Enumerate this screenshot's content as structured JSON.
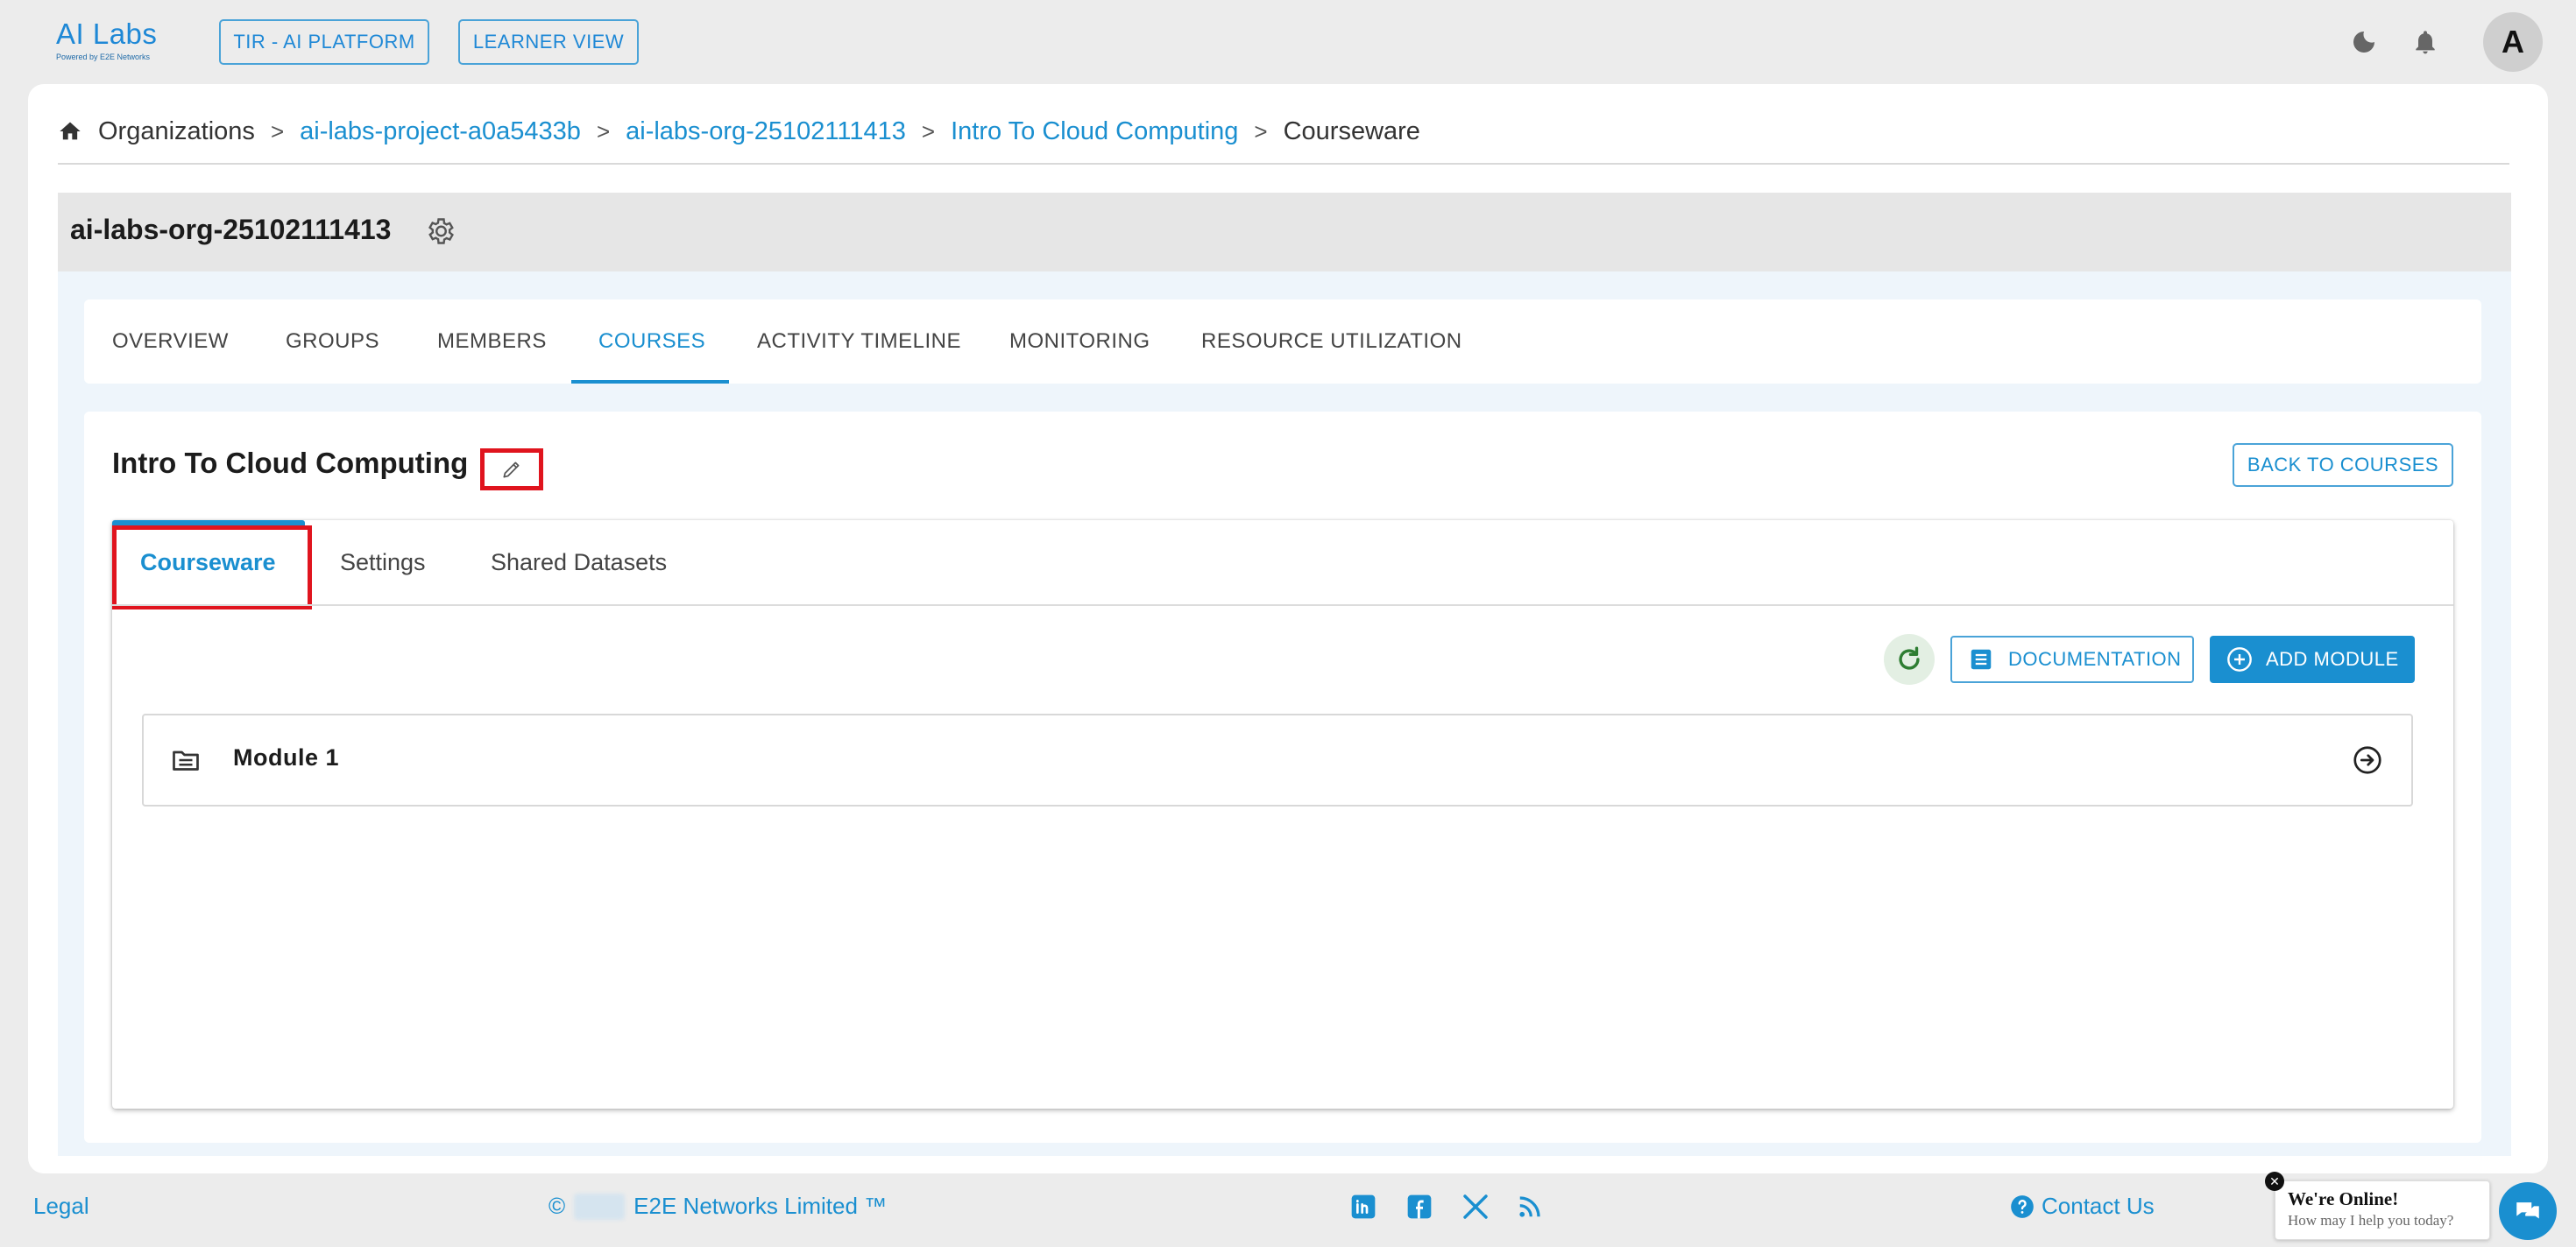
{
  "logo": {
    "name": "AI Labs",
    "subtitle": "Powered by E2E Networks"
  },
  "topbar": {
    "btn_platform": "TIR - AI PLATFORM",
    "btn_learner": "LEARNER VIEW",
    "avatar_initial": "A"
  },
  "breadcrumb": {
    "home": "Organizations",
    "sep": ">",
    "items": [
      "ai-labs-project-a0a5433b",
      "ai-labs-org-25102111413",
      "Intro To Cloud Computing"
    ],
    "current": "Courseware"
  },
  "org": {
    "title": "ai-labs-org-25102111413"
  },
  "tabs": [
    "OVERVIEW",
    "GROUPS",
    "MEMBERS",
    "COURSES",
    "ACTIVITY TIMELINE",
    "MONITORING",
    "RESOURCE UTILIZATION"
  ],
  "active_tab": "COURSES",
  "course": {
    "title": "Intro To Cloud Computing",
    "back_label": "BACK TO COURSES"
  },
  "sub_tabs": [
    "Courseware",
    "Settings",
    "Shared Datasets"
  ],
  "actions": {
    "documentation": "DOCUMENTATION",
    "add_module": "ADD MODULE"
  },
  "modules": [
    {
      "name": "Module 1"
    }
  ],
  "footer": {
    "legal": "Legal",
    "copyright_symbol": "©",
    "company": "E2E Networks Limited ™",
    "contact": "Contact Us"
  },
  "chat": {
    "title": "We're Online!",
    "subtitle": "How may I help you today?"
  },
  "colors": {
    "accent": "#1a8fd0",
    "highlight": "#e0141e",
    "background": "#ececec"
  }
}
